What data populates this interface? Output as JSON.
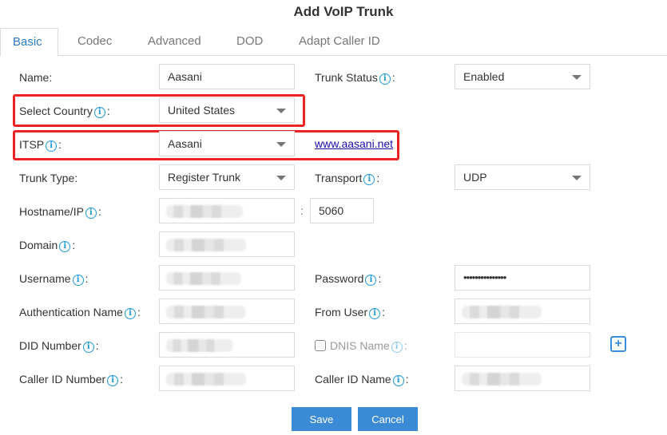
{
  "title": "Add VoIP Trunk",
  "tabs": [
    {
      "label": "Basic",
      "active": true
    },
    {
      "label": "Codec",
      "active": false
    },
    {
      "label": "Advanced",
      "active": false
    },
    {
      "label": "DOD",
      "active": false
    },
    {
      "label": "Adapt Caller ID",
      "active": false
    }
  ],
  "form": {
    "name": {
      "label": "Name:",
      "value": "Aasani"
    },
    "trunk_status": {
      "label": "Trunk Status",
      "value": "Enabled"
    },
    "select_country": {
      "label": "Select Country",
      "value": "United States"
    },
    "itsp": {
      "label": "ITSP",
      "value": "Aasani",
      "link": "www.aasani.net"
    },
    "trunk_type": {
      "label": "Trunk Type:",
      "value": "Register Trunk"
    },
    "transport": {
      "label": "Transport",
      "value": "UDP"
    },
    "hostname": {
      "label": "Hostname/IP",
      "value": "",
      "port_separator": ":",
      "port": "5060"
    },
    "domain": {
      "label": "Domain",
      "value": ""
    },
    "username": {
      "label": "Username",
      "value": ""
    },
    "password": {
      "label": "Password",
      "value": "•••••••••••••••"
    },
    "auth_name": {
      "label": "Authentication Name",
      "value": ""
    },
    "from_user": {
      "label": "From User",
      "value": ""
    },
    "did_number": {
      "label": "DID Number",
      "value": ""
    },
    "dnis_name": {
      "label": "DNIS Name",
      "value": "",
      "checked": false,
      "add_icon": "plus-square-icon"
    },
    "caller_id_number": {
      "label": "Caller ID Number",
      "value": ""
    },
    "caller_id_name": {
      "label": "Caller ID Name",
      "value": ""
    },
    "colon": ":",
    "info_glyph": "i"
  },
  "buttons": {
    "save": "Save",
    "cancel": "Cancel"
  },
  "colors": {
    "accent": "#3a8ad6",
    "tab_active": "#2a7bc2",
    "info_icon": "#1e9ad6",
    "highlight": "#ee2222"
  }
}
